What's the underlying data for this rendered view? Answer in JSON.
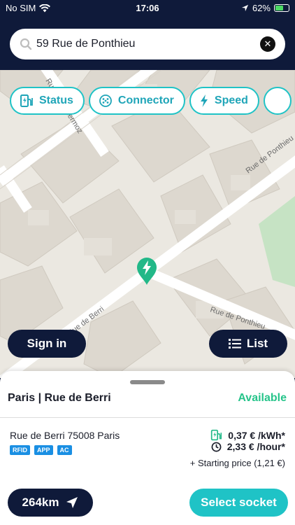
{
  "status_bar": {
    "carrier": "No SIM",
    "time": "17:06",
    "battery": "62%",
    "battery_level": 0.62
  },
  "search": {
    "value": "59 Rue de Ponthieu"
  },
  "filters": [
    {
      "label": "Status",
      "icon": "charging-station-icon"
    },
    {
      "label": "Connector",
      "icon": "connector-icon"
    },
    {
      "label": "Speed",
      "icon": "bolt-icon"
    }
  ],
  "map": {
    "street_labels": [
      "Rue de Ponthieu",
      "Rue de Ponthieu",
      "Rue de Berri",
      "Rue Jean Mermoz"
    ]
  },
  "buttons": {
    "sign_in": "Sign in",
    "list": "List",
    "distance": "264km",
    "select_socket": "Select socket"
  },
  "station": {
    "name": "Paris | Rue de Berri",
    "status": "Available",
    "address": "Rue de Berri 75008 Paris",
    "badges": [
      "RFID",
      "APP",
      "AC"
    ],
    "price_kwh": "0,37 € /kWh*",
    "price_hour": "2,33 € /hour*",
    "starting_price": "+ Starting price (1,21 €)"
  },
  "colors": {
    "navy": "#0f1a3a",
    "teal": "#1fc3c6",
    "available": "#26c48a",
    "badge": "#1a8fe3",
    "map": "#ebe8e1"
  }
}
